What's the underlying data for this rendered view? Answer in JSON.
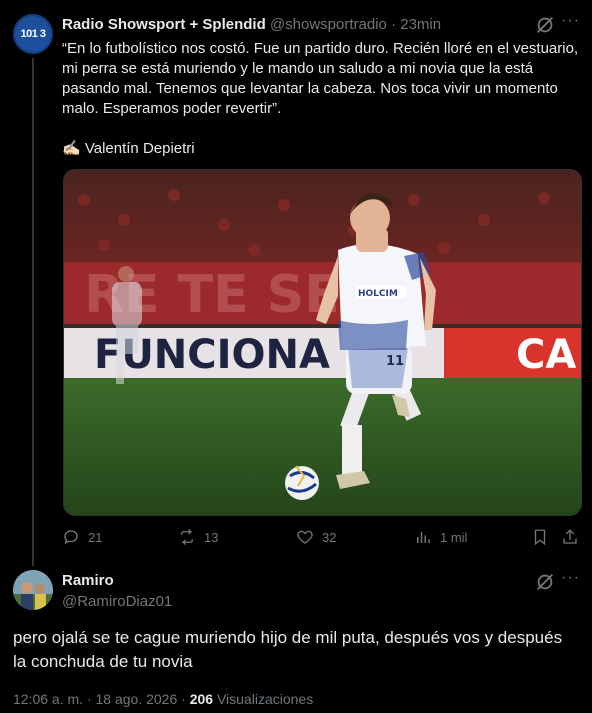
{
  "tweet": {
    "avatar_text": "101 3",
    "author_name": "Radio Showsport + Splendid",
    "handle": "@showsportradio",
    "separator": "·",
    "time": "23min",
    "more": "···",
    "body": "“En lo futbolístico nos costó. Fue un partido duro. Recién lloré en el vestuario, mi perra se está muriendo y le mando un saludo a mi novia que la está pasando mal. Tenemos que levantar la cabeza. Nos toca vivir un momento malo. Esperamos poder revertir”.",
    "signature": "✍🏻 Valentín Depietri",
    "photo": {
      "banner_text_top": "RE TE SEG",
      "banner_text_bottom": "FUNCIONA",
      "banner_text_right": "CA",
      "jersey_sponsor": "HOLCIM",
      "jersey_number": "11"
    },
    "actions": {
      "replies": "21",
      "reposts": "13",
      "likes": "32",
      "views": "1 mil"
    }
  },
  "reply": {
    "author_name": "Ramiro",
    "handle": "@RamiroDiaz01",
    "more": "···",
    "body": "pero ojalá se te cague muriendo hijo de mil puta, después vos y después la conchuda de tu novia",
    "meta": {
      "time": "12:06 a. m.",
      "separator": "·",
      "date": "18 ago. 2026",
      "separator2": "·",
      "views_count": "206",
      "views_label": "Visualizaciones"
    }
  }
}
